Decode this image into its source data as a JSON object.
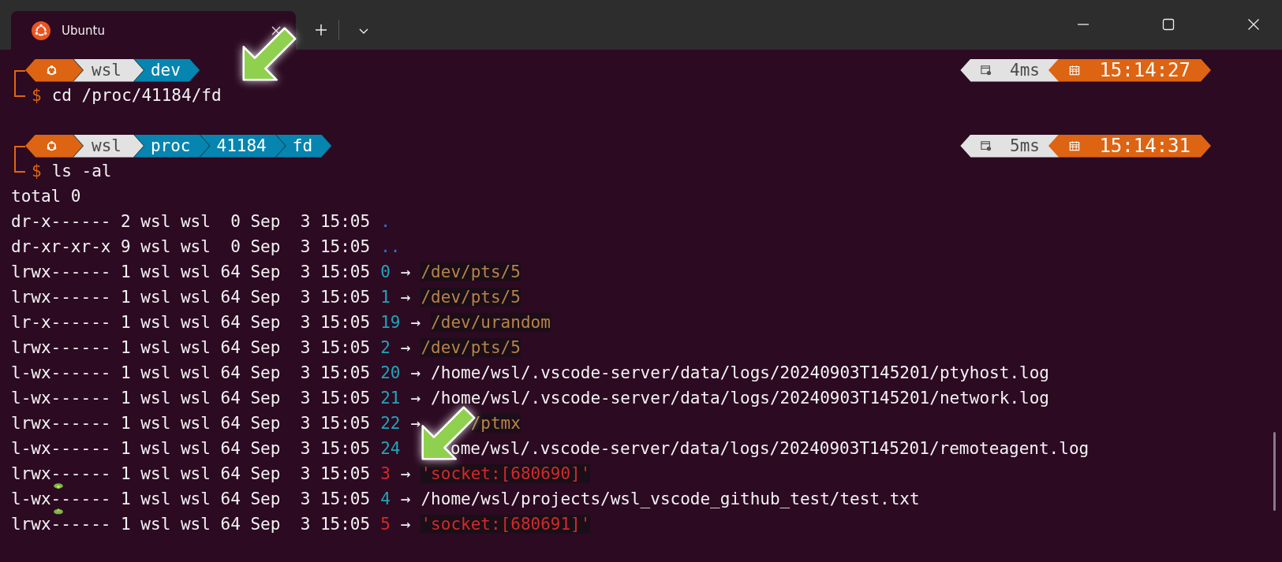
{
  "window": {
    "tabs": [
      {
        "title": "Ubuntu",
        "selected": true
      }
    ]
  },
  "blocks": [
    {
      "segments": [
        {
          "kind": "os"
        },
        {
          "kind": "user",
          "text": "wsl"
        },
        {
          "kind": "path",
          "text": "dev"
        }
      ],
      "prompt_symbol": "$",
      "command": "cd /proc/41184/fd",
      "duration": "4ms",
      "time": "15:14:27"
    },
    {
      "segments": [
        {
          "kind": "os"
        },
        {
          "kind": "user",
          "text": "wsl"
        },
        {
          "kind": "path",
          "text": "proc"
        },
        {
          "kind": "path",
          "text": "41184"
        },
        {
          "kind": "path",
          "text": "fd"
        }
      ],
      "prompt_symbol": "$",
      "command": "ls -al",
      "duration": "5ms",
      "time": "15:14:31",
      "output": [
        {
          "kind": "plain",
          "text": "total 0"
        },
        {
          "kind": "entry",
          "meta": "dr-x------ 2 wsl wsl  0 Sep  3 15:05",
          "target": {
            "kind": "dir",
            "text": "."
          }
        },
        {
          "kind": "entry",
          "meta": "dr-xr-xr-x 9 wsl wsl  0 Sep  3 15:05",
          "target": {
            "kind": "dir",
            "text": ".."
          }
        },
        {
          "kind": "entry",
          "meta": "lrwx------ 1 wsl wsl 64 Sep  3 15:05",
          "fd": "0",
          "arrow": "→",
          "target": {
            "kind": "device",
            "text": "/dev/pts/5"
          }
        },
        {
          "kind": "entry",
          "meta": "lrwx------ 1 wsl wsl 64 Sep  3 15:05",
          "fd": "1",
          "arrow": "→",
          "target": {
            "kind": "device",
            "text": "/dev/pts/5"
          }
        },
        {
          "kind": "entry",
          "meta": "lr-x------ 1 wsl wsl 64 Sep  3 15:05",
          "fd": "19",
          "arrow": "→",
          "target": {
            "kind": "device",
            "text": "/dev/urandom"
          }
        },
        {
          "kind": "entry",
          "meta": "lrwx------ 1 wsl wsl 64 Sep  3 15:05",
          "fd": "2",
          "arrow": "→",
          "target": {
            "kind": "device",
            "text": "/dev/pts/5"
          }
        },
        {
          "kind": "entry",
          "meta": "l-wx------ 1 wsl wsl 64 Sep  3 15:05",
          "fd": "20",
          "arrow": "→",
          "target": {
            "kind": "file",
            "text": "/home/wsl/.vscode-server/data/logs/20240903T145201/ptyhost.log"
          }
        },
        {
          "kind": "entry",
          "meta": "l-wx------ 1 wsl wsl 64 Sep  3 15:05",
          "fd": "21",
          "arrow": "→",
          "target": {
            "kind": "file",
            "text": "/home/wsl/.vscode-server/data/logs/20240903T145201/network.log"
          }
        },
        {
          "kind": "entry",
          "meta": "lrwx------ 1 wsl wsl 64 Sep  3 15:05",
          "fd": "22",
          "arrow": "→",
          "covered": true,
          "target": {
            "kind": "device",
            "text": "/ptmx"
          }
        },
        {
          "kind": "entry",
          "meta": "l-wx------ 1 wsl wsl 64 Sep  3 15:05",
          "fd": "24",
          "covered": true,
          "target": {
            "kind": "file",
            "text": "ome/wsl/.vscode-server/data/logs/20240903T145201/remoteagent.log"
          }
        },
        {
          "kind": "entry",
          "meta": "lrwx------ 1 wsl wsl 64 Sep  3 15:05",
          "fd": "3",
          "arrow": "→",
          "target": {
            "kind": "socket",
            "text": "'socket:[680690]'"
          }
        },
        {
          "kind": "entry",
          "meta": "l-wx------ 1 wsl wsl 64 Sep  3 15:05",
          "fd": "4",
          "arrow": "→",
          "target": {
            "kind": "file",
            "text": "/home/wsl/projects/wsl_vscode_github_test/test.txt"
          }
        },
        {
          "kind": "entry",
          "meta": "lrwx------ 1 wsl wsl 64 Sep  3 15:05",
          "fd": "5",
          "arrow": "→",
          "target": {
            "kind": "socket",
            "text": "'socket:[680691]'"
          }
        }
      ]
    }
  ]
}
